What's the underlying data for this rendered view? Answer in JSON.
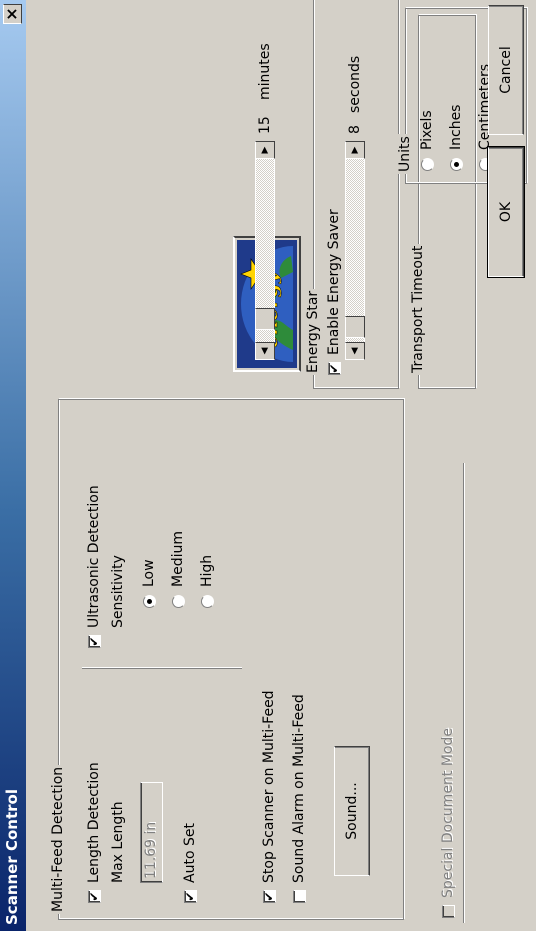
{
  "window": {
    "title": "Scanner Control",
    "close_glyph": "×"
  },
  "multifeed": {
    "legend": "Multi-Feed Detection",
    "length_detection": {
      "label": "Length Detection",
      "checked": true
    },
    "max_length_label": "Max Length",
    "max_length_value": "11.69 in",
    "auto_set": {
      "label": "Auto Set",
      "checked": true
    },
    "ultrasonic": {
      "label": "Ultrasonic Detection",
      "checked": true
    },
    "sensitivity_label": "Sensitivity",
    "sensitivity_options": [
      {
        "label": "Low",
        "selected": true
      },
      {
        "label": "Medium",
        "selected": false
      },
      {
        "label": "High",
        "selected": false
      }
    ],
    "stop_scanner": {
      "label": "Stop Scanner on Multi-Feed",
      "checked": true
    },
    "sound_alarm": {
      "label": "Sound Alarm on Multi-Feed",
      "checked": false
    },
    "sound_button": "Sound..."
  },
  "special_document_mode": {
    "label": "Special Document Mode",
    "checked": false,
    "enabled": false
  },
  "logo": {
    "icon": "energy-star-logo-icon",
    "script_text": "energy"
  },
  "energy_star": {
    "legend": "Energy Star",
    "enable": {
      "label": "Enable Energy Saver",
      "checked": true
    },
    "value": "15",
    "unit": "minutes"
  },
  "transport_timeout": {
    "legend": "Transport Timeout",
    "value": "8",
    "unit": "seconds"
  },
  "units": {
    "legend": "Units",
    "options": [
      {
        "label": "Pixels",
        "selected": false
      },
      {
        "label": "Inches",
        "selected": true
      },
      {
        "label": "Centimeters",
        "selected": false
      }
    ]
  },
  "buttons": {
    "ok": "OK",
    "cancel": "Cancel"
  },
  "glyphs": {
    "check": "✔",
    "arrow_left": "◀",
    "arrow_right": "▶"
  },
  "colors": {
    "title_start": "#0a246a",
    "title_end": "#a6caf0",
    "face": "#d4d0c8"
  }
}
